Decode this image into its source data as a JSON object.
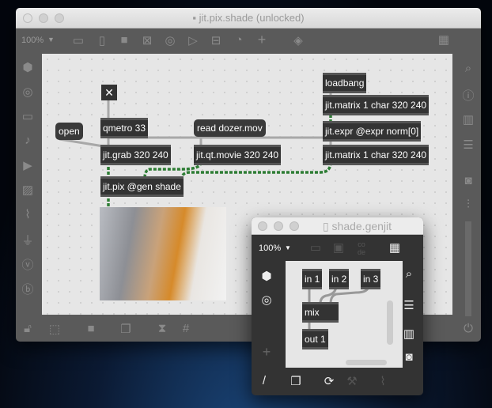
{
  "main_window": {
    "title": "jit.pix.shade (unlocked)",
    "zoom": "100%",
    "objects": {
      "toggle": "✕",
      "qmetro": "qmetro 33",
      "open": "open",
      "read": "read dozer.mov",
      "loadbang": "loadbang",
      "matrix_top": "jit.matrix 1 char 320 240",
      "expr": "jit.expr @expr norm[0]",
      "grab": "jit.grab 320 240",
      "movie": "jit.qt.movie 320 240",
      "matrix_bottom": "jit.matrix 1 char 320 240",
      "pix": "jit.pix @gen shade"
    }
  },
  "sub_window": {
    "title": "shade.genjit",
    "zoom": "100%",
    "objects": {
      "in1": "in 1",
      "in2": "in 2",
      "in3": "in 3",
      "mix": "mix",
      "out1": "out 1"
    }
  },
  "colors": {
    "toolbar": "#5a5a5a",
    "canvas": "#e6e6e6",
    "sub_toolbar": "#333333",
    "cord_matrix": "#3fa34d"
  }
}
